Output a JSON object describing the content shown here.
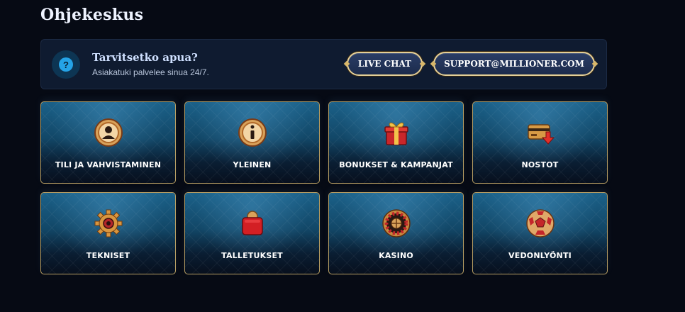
{
  "page": {
    "title": "Ohjekeskus"
  },
  "help": {
    "icon": "question-icon",
    "title": "Tarvitsetko apua?",
    "subtitle": "Asiakatuki palvelee sinua 24/7.",
    "live_chat_label": "LIVE CHAT",
    "support_label": "SUPPORT@MILLIONER.COM",
    "accent_color": "#25a3e6",
    "border_color": "#e4cf97"
  },
  "categories": [
    {
      "label": "TILI JA VAHVISTAMINEN",
      "icon": "user-account-icon"
    },
    {
      "label": "YLEINEN",
      "icon": "info-icon"
    },
    {
      "label": "BONUKSET & KAMPANJAT",
      "icon": "gift-box-icon"
    },
    {
      "label": "NOSTOT",
      "icon": "card-withdraw-icon"
    },
    {
      "label": "TEKNISET",
      "icon": "gear-icon"
    },
    {
      "label": "TALLETUKSET",
      "icon": "wallet-icon"
    },
    {
      "label": "KASINO",
      "icon": "roulette-icon"
    },
    {
      "label": "VEDONLYÖNTI",
      "icon": "football-icon"
    }
  ]
}
